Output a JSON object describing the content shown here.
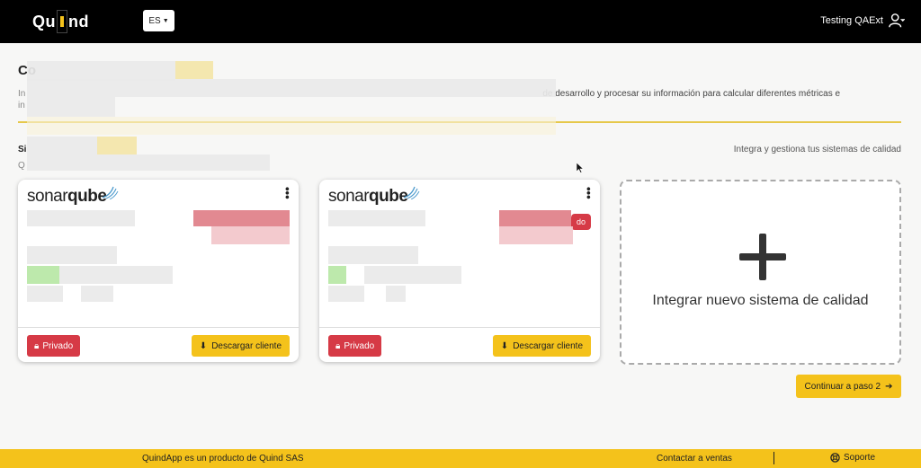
{
  "header": {
    "logo_text": "Quind",
    "language": "ES",
    "user_name": "Testing QAExt"
  },
  "page": {
    "title": "Co",
    "intro_visible": "de desarrollo y procesar su información para calcular diferentes métricas e",
    "section_title": "Si",
    "section_subtitle": "Q",
    "section_right": "Integra y gestiona tus sistemas de calidad"
  },
  "cards": [
    {
      "brand_light": "sonar",
      "brand_bold": "qube",
      "status": "",
      "private_label": "Privado",
      "download_label": "Descargar cliente"
    },
    {
      "brand_light": "sonar",
      "brand_bold": "qube",
      "status": "do",
      "private_label": "Privado",
      "download_label": "Descargar cliente"
    }
  ],
  "add_card": {
    "label": "Integrar nuevo sistema de calidad"
  },
  "continue_label": "Continuar a paso 2",
  "footer": {
    "product": "QuindApp es un producto de Quind SAS",
    "sales": "Contactar a ventas",
    "support": "Soporte"
  },
  "colors": {
    "accent": "#f4c21b",
    "danger": "#d63a46",
    "topbar": "#000000"
  }
}
